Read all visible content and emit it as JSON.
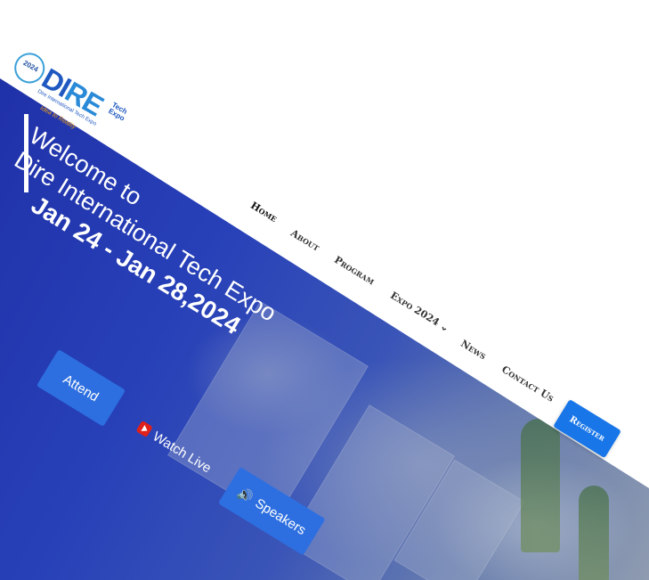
{
  "logo": {
    "year": "2024",
    "main_left": "DI",
    "main_right": "RE",
    "side": "Tech Expo",
    "small": "Dire International Tech Expo",
    "tagline": "Idea to Reality"
  },
  "hero": {
    "welcome_line1": "Welcome to",
    "welcome_line2": "Dire International Tech Expo",
    "dates": "Jan 24 - Jan 28,2024"
  },
  "nav": {
    "home": "Home",
    "about": "About",
    "program": "Program",
    "expo": "Expo 2024 ⌄",
    "news": "News",
    "contact": "Contact Us",
    "register": "Register"
  },
  "buttons": {
    "attend": "Attend",
    "watch_live": "Watch Live",
    "speakers": "Speakers"
  },
  "colors": {
    "primary": "#2d6fe0",
    "register": "#1976e8",
    "hero_blue": "#2740b8"
  },
  "icons": {
    "watch": "youtube-play-icon",
    "speakers": "speaker-icon"
  }
}
